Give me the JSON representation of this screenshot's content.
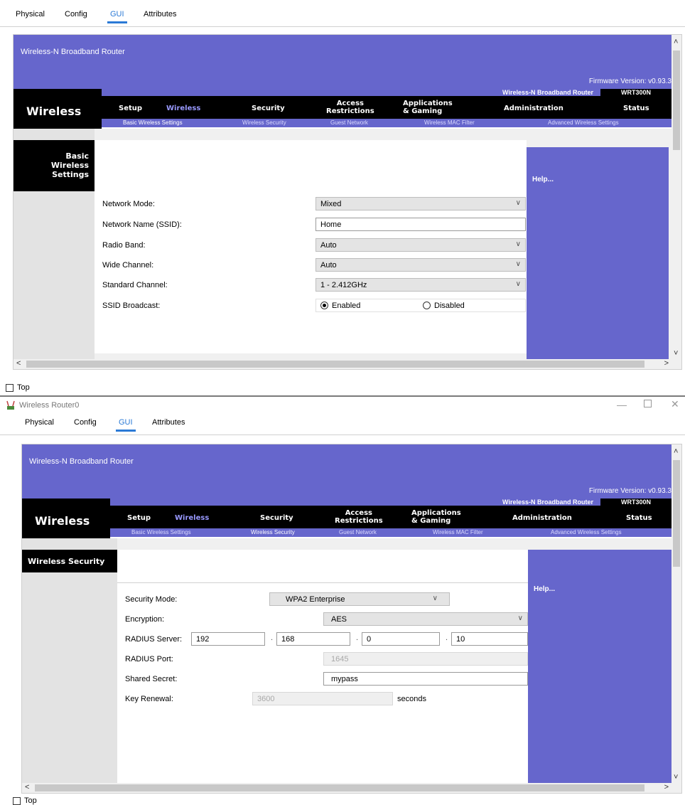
{
  "top_window": {
    "tabs": [
      "Physical",
      "Config",
      "GUI",
      "Attributes"
    ],
    "active_tab": "GUI",
    "brand": "Wireless-N Broadband Router",
    "firmware": "Firmware Version: v0.93.3",
    "nav_title": "Wireless",
    "router_title": "Wireless-N Broadband Router",
    "model": "WRT300N",
    "nav": {
      "setup": "Setup",
      "wireless": "Wireless",
      "security": "Security",
      "access1": "Access",
      "access2": "Restrictions",
      "apps1": "Applications",
      "apps2": "& Gaming",
      "admin": "Administration",
      "status": "Status"
    },
    "subnav": [
      "Basic Wireless Settings",
      "Wireless Security",
      "Guest Network",
      "Wireless MAC Filter",
      "Advanced Wireless Settings"
    ],
    "section_title_lines": [
      "Basic",
      "Wireless",
      "Settings"
    ],
    "help": "Help...",
    "fields": {
      "network_mode_label": "Network Mode:",
      "network_mode_value": "Mixed",
      "ssid_label": "Network Name (SSID):",
      "ssid_value": "Home",
      "radio_band_label": "Radio Band:",
      "radio_band_value": "Auto",
      "wide_channel_label": "Wide Channel:",
      "wide_channel_value": "Auto",
      "standard_channel_label": "Standard Channel:",
      "standard_channel_value": "1 - 2.412GHz",
      "ssid_broadcast_label": "SSID Broadcast:",
      "enabled_label": "Enabled",
      "disabled_label": "Disabled"
    },
    "top_checkbox_label": "Top"
  },
  "bottom_window": {
    "title": "Wireless Router0",
    "tabs": [
      "Physical",
      "Config",
      "GUI",
      "Attributes"
    ],
    "active_tab": "GUI",
    "brand": "Wireless-N Broadband Router",
    "firmware": "Firmware Version: v0.93.3",
    "nav_title": "Wireless",
    "router_title": "Wireless-N Broadband Router",
    "model": "WRT300N",
    "nav": {
      "setup": "Setup",
      "wireless": "Wireless",
      "security": "Security",
      "access1": "Access",
      "access2": "Restrictions",
      "apps1": "Applications",
      "apps2": "& Gaming",
      "admin": "Administration",
      "status": "Status"
    },
    "subnav": [
      "Basic Wireless Settings",
      "Wireless Security",
      "Guest Network",
      "Wireless MAC Filter",
      "Advanced Wireless Settings"
    ],
    "section_title": "Wireless Security",
    "help": "Help...",
    "fields": {
      "security_mode_label": "Security Mode:",
      "security_mode_value": "WPA2 Enterprise",
      "encryption_label": "Encryption:",
      "encryption_value": "AES",
      "radius_server_label": "RADIUS Server:",
      "ip1": "192",
      "ip2": "168",
      "ip3": "0",
      "ip4": "10",
      "radius_port_label": "RADIUS Port:",
      "radius_port_value": "1645",
      "shared_secret_label": "Shared Secret:",
      "shared_secret_value": "mypass",
      "key_renewal_label": "Key Renewal:",
      "key_renewal_value": "3600",
      "seconds_label": "seconds"
    },
    "top_checkbox_label": "Top"
  },
  "colors": {
    "linksys_purple": "#6666cc",
    "nav_black": "#000000",
    "active_tab_blue": "#2b7ad6"
  }
}
